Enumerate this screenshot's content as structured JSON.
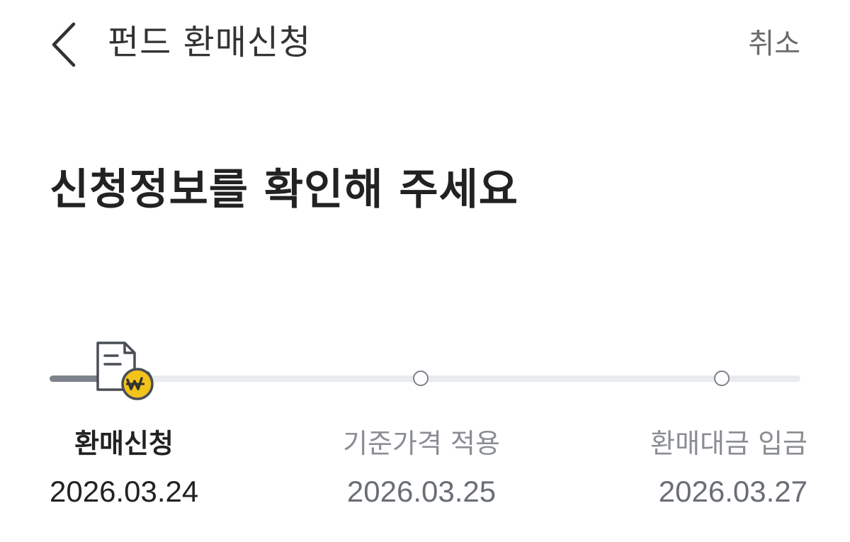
{
  "header": {
    "title": "펀드 환매신청",
    "cancel_label": "취소",
    "back_icon": "chevron-left-icon"
  },
  "main": {
    "heading": "신청정보를 확인해 주세요"
  },
  "timeline": {
    "progress": 0.08,
    "colors": {
      "track": "#e9ebee",
      "fill": "#7d828c",
      "accent": "#f2c318"
    },
    "current_icon": "document-won-icon",
    "steps": [
      {
        "label": "환매신청",
        "date": "2026.03.24",
        "state": "current"
      },
      {
        "label": "기준가격 적용",
        "date": "2026.03.25",
        "state": "upcoming"
      },
      {
        "label": "환매대금 입금",
        "date": "2026.03.27",
        "state": "upcoming"
      }
    ]
  }
}
